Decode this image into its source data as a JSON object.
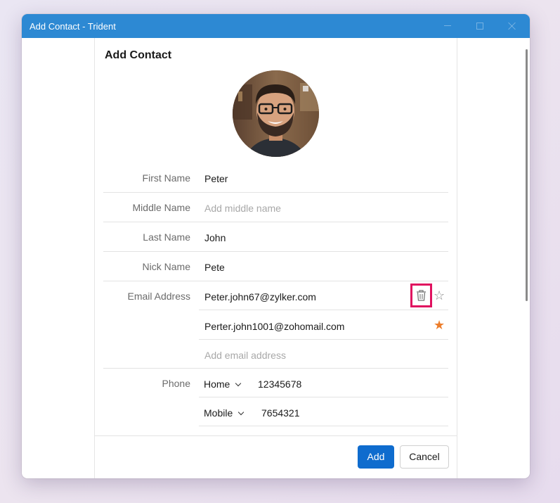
{
  "window": {
    "title": "Add Contact - Trident"
  },
  "form": {
    "heading": "Add Contact",
    "fields": {
      "first_name": {
        "label": "First Name",
        "value": "Peter"
      },
      "middle_name": {
        "label": "Middle Name",
        "placeholder": "Add middle name"
      },
      "last_name": {
        "label": "Last Name",
        "value": "John"
      },
      "nick_name": {
        "label": "Nick Name",
        "value": "Pete"
      }
    },
    "email": {
      "label": "Email Address",
      "entries": [
        {
          "value": "Peter.john67@zylker.com",
          "starred": false
        },
        {
          "value": "Perter.john1001@zohomail.com",
          "starred": true
        }
      ],
      "add_placeholder": "Add email address"
    },
    "phone": {
      "label": "Phone",
      "entries": [
        {
          "type": "Home",
          "value": "12345678"
        },
        {
          "type": "Mobile",
          "value": "7654321"
        }
      ]
    }
  },
  "buttons": {
    "add": "Add",
    "cancel": "Cancel"
  },
  "colors": {
    "titlebar": "#2d89d3",
    "primary_button": "#0f6cce",
    "highlight_box": "#e0115f",
    "star_filled": "#ec7d2b"
  }
}
